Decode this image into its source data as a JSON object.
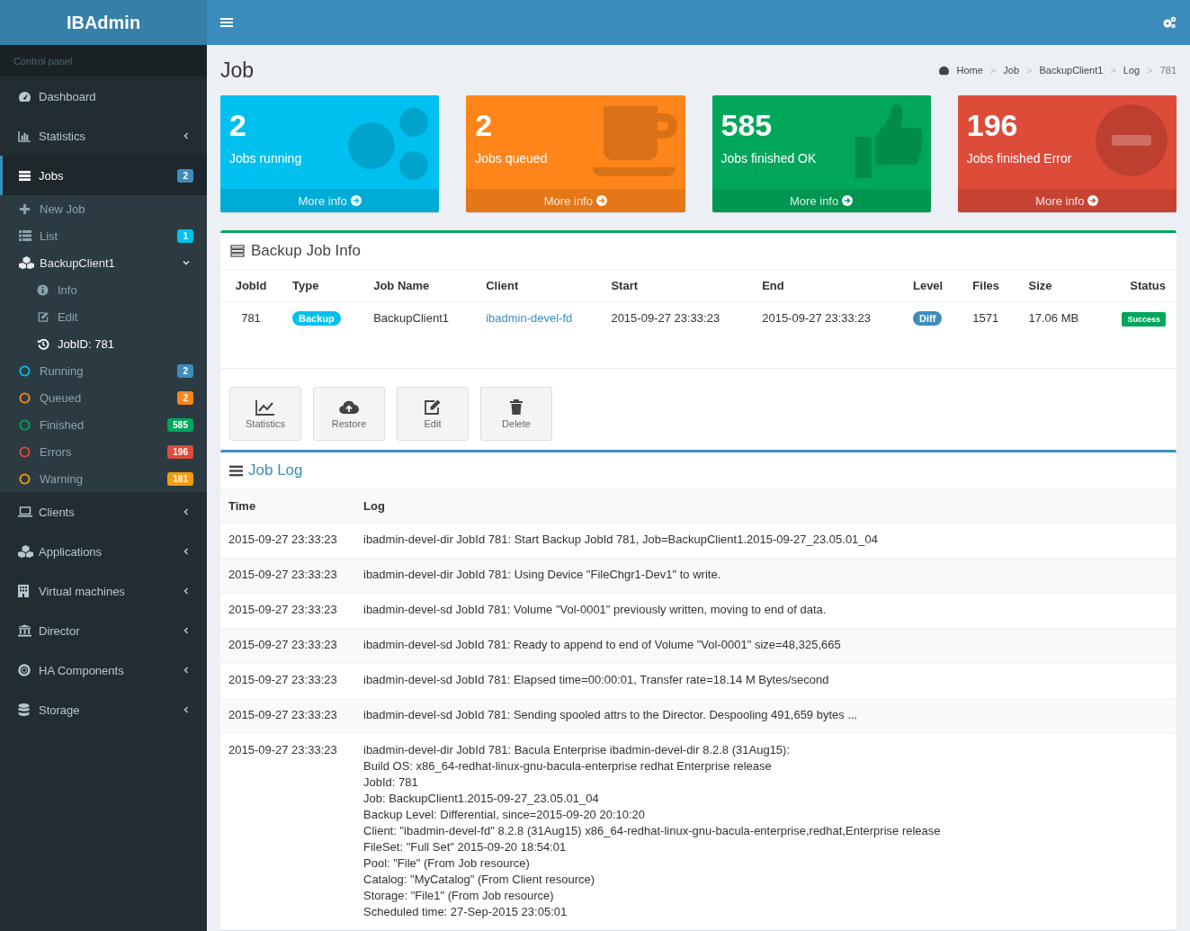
{
  "brand": "IBAdmin",
  "sidebar": {
    "header": "Control panel",
    "menu": [
      {
        "label": "Dashboard",
        "kind": "link",
        "selected": false
      },
      {
        "label": "Statistics",
        "kind": "tree",
        "expanded": false,
        "selected": false
      },
      {
        "label": "Jobs",
        "kind": "tree",
        "expanded": true,
        "selected": true,
        "badge": {
          "text": "2",
          "color": "#3c8dbc"
        },
        "children": [
          {
            "label": "New Job",
            "kind": "link",
            "selected": false
          },
          {
            "label": "List",
            "kind": "link",
            "selected": false,
            "badge": {
              "text": "1",
              "color": "#00c0ef"
            }
          },
          {
            "label": "BackupClient1",
            "kind": "tree",
            "expanded": true,
            "selected": false,
            "children": [
              {
                "label": "Info",
                "kind": "link",
                "selected": false
              },
              {
                "label": "Edit",
                "kind": "link",
                "selected": false
              },
              {
                "label": "JobID: 781",
                "kind": "link",
                "selected": true
              }
            ]
          },
          {
            "label": "Running",
            "kind": "status",
            "color": "#00c0ef",
            "selected": false,
            "badge": {
              "text": "2",
              "color": "#3c8dbc"
            }
          },
          {
            "label": "Queued",
            "kind": "status",
            "color": "#ff851b",
            "selected": false,
            "badge": {
              "text": "2",
              "color": "#ff851b"
            }
          },
          {
            "label": "Finished",
            "kind": "status",
            "color": "#00a65a",
            "selected": false,
            "badge": {
              "text": "585",
              "color": "#00a65a"
            }
          },
          {
            "label": "Errors",
            "kind": "status",
            "color": "#dd4b39",
            "selected": false,
            "badge": {
              "text": "196",
              "color": "#dd4b39"
            }
          },
          {
            "label": "Warning",
            "kind": "status",
            "color": "#f39c12",
            "selected": false,
            "badge": {
              "text": "181",
              "color": "#f39c12"
            }
          }
        ]
      },
      {
        "label": "Clients",
        "kind": "tree",
        "expanded": false,
        "selected": false
      },
      {
        "label": "Applications",
        "kind": "tree",
        "expanded": false,
        "selected": false
      },
      {
        "label": "Virtual machines",
        "kind": "tree",
        "expanded": false,
        "selected": false
      },
      {
        "label": "Director",
        "kind": "tree",
        "expanded": false,
        "selected": false
      },
      {
        "label": "HA Components",
        "kind": "tree",
        "expanded": false,
        "selected": false
      },
      {
        "label": "Storage",
        "kind": "tree",
        "expanded": false,
        "selected": false
      }
    ]
  },
  "page_title": "Job",
  "breadcrumb": {
    "separator": ">",
    "items": [
      "Home",
      "Job",
      "BackupClient1",
      "Log",
      "781"
    ]
  },
  "info_boxes": [
    {
      "value": "2",
      "label": "Jobs running",
      "link": "More info",
      "color": "#00c0ef"
    },
    {
      "value": "2",
      "label": "Jobs queued",
      "link": "More info",
      "color": "#ff851b"
    },
    {
      "value": "585",
      "label": "Jobs finished OK",
      "link": "More info",
      "color": "#00a65a"
    },
    {
      "value": "196",
      "label": "Jobs finished Error",
      "link": "More info",
      "color": "#dd4b39"
    }
  ],
  "job_info": {
    "title": "Backup Job Info",
    "columns": [
      "JobId",
      "Type",
      "Job Name",
      "Client",
      "Start",
      "End",
      "Level",
      "Files",
      "Size",
      "Status"
    ],
    "rows": [
      [
        {
          "text": "781",
          "kind": "text"
        },
        {
          "text": "Backup",
          "kind": "pill",
          "color": "#00c0ef"
        },
        {
          "text": "BackupClient1",
          "kind": "text"
        },
        {
          "text": "ibadmin-devel-fd",
          "kind": "link"
        },
        {
          "text": "2015-09-27 23:33:23",
          "kind": "text"
        },
        {
          "text": "2015-09-27 23:33:23",
          "kind": "text"
        },
        {
          "text": "Diff",
          "kind": "pill",
          "color": "#3c8dbc"
        },
        {
          "text": "1571",
          "kind": "text"
        },
        {
          "text": "17.06 MB",
          "kind": "text"
        },
        {
          "text": "Success",
          "kind": "label",
          "color": "#00a65a"
        }
      ]
    ],
    "actions": [
      "Statistics",
      "Restore",
      "Edit",
      "Delete"
    ]
  },
  "job_log": {
    "title": "Job Log",
    "columns": [
      "Time",
      "Log"
    ],
    "rows": [
      {
        "time": "2015-09-27 23:33:23",
        "lines": [
          "ibadmin-devel-dir JobId 781: Start Backup JobId 781, Job=BackupClient1.2015-09-27_23.05.01_04"
        ]
      },
      {
        "time": "2015-09-27 23:33:23",
        "lines": [
          "ibadmin-devel-dir JobId 781: Using Device \"FileChgr1-Dev1\" to write."
        ]
      },
      {
        "time": "2015-09-27 23:33:23",
        "lines": [
          "ibadmin-devel-sd JobId 781: Volume \"Vol-0001\" previously written, moving to end of data."
        ]
      },
      {
        "time": "2015-09-27 23:33:23",
        "lines": [
          "ibadmin-devel-sd JobId 781: Ready to append to end of Volume \"Vol-0001\" size=48,325,665"
        ]
      },
      {
        "time": "2015-09-27 23:33:23",
        "lines": [
          "ibadmin-devel-sd JobId 781: Elapsed time=00:00:01, Transfer rate=18.14 M Bytes/second"
        ]
      },
      {
        "time": "2015-09-27 23:33:23",
        "lines": [
          "ibadmin-devel-sd JobId 781: Sending spooled attrs to the Director. Despooling 491,659 bytes ..."
        ]
      },
      {
        "time": "2015-09-27 23:33:23",
        "lines": [
          "ibadmin-devel-dir JobId 781: Bacula Enterprise ibadmin-devel-dir 8.2.8 (31Aug15):",
          "Build OS: x86_64-redhat-linux-gnu-bacula-enterprise redhat Enterprise release",
          "JobId: 781",
          "Job: BackupClient1.2015-09-27_23.05.01_04",
          "Backup Level: Differential, since=2015-09-20 20:10:20",
          "Client: \"ibadmin-devel-fd\" 8.2.8 (31Aug15) x86_64-redhat-linux-gnu-bacula-enterprise,redhat,Enterprise release",
          "FileSet: \"Full Set\" 2015-09-20 18:54:01",
          "Pool: \"File\" (From Job resource)",
          "Catalog: \"MyCatalog\" (From Client resource)",
          "Storage: \"File1\" (From Job resource)",
          "Scheduled time: 27-Sep-2015 23:05:01"
        ]
      }
    ]
  }
}
